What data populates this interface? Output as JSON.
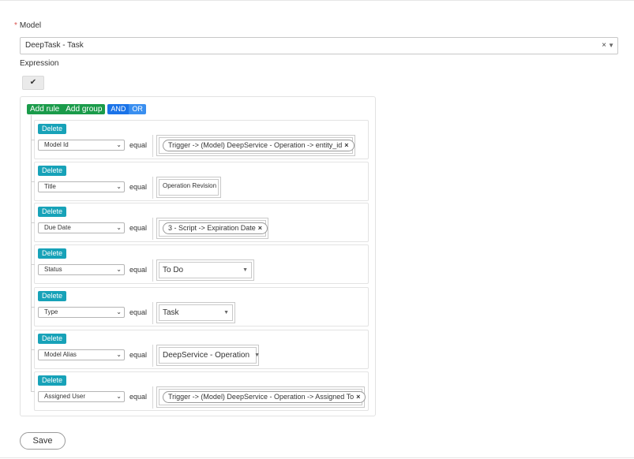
{
  "model": {
    "label": "Model",
    "required_mark": "*",
    "selected": "DeepTask - Task",
    "clear_glyph": "×",
    "caret_glyph": "▼"
  },
  "expression": {
    "label": "Expression",
    "check_icon": "double-check-icon",
    "check_glyph": "✔"
  },
  "builder": {
    "add_rule": "Add rule",
    "add_group": "Add group",
    "and_label": "AND",
    "or_label": "OR",
    "delete_label": "Delete",
    "rules": [
      {
        "field": "Model Id",
        "operator": "equal",
        "value": "Trigger -> (Model) DeepService - Operation -> entity_id"
      },
      {
        "field": "Title",
        "operator": "equal",
        "value": "Operation Revision"
      },
      {
        "field": "Due Date",
        "operator": "equal",
        "value": "3 - Script -> Expiration Date"
      },
      {
        "field": "Status",
        "operator": "equal",
        "value": "To Do"
      },
      {
        "field": "Type",
        "operator": "equal",
        "value": "Task"
      },
      {
        "field": "Model Alias",
        "operator": "equal",
        "value": "DeepService - Operation"
      },
      {
        "field": "Assigned User",
        "operator": "equal",
        "value": "Trigger -> (Model) DeepService - Operation -> Assigned To"
      }
    ]
  },
  "save_label": "Save",
  "colors": {
    "green": "#1a9b4a",
    "blue": "#1a73e8",
    "teal": "#17a2b8",
    "required": "#d9534f"
  }
}
